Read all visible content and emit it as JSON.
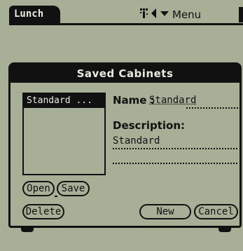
{
  "topbar": {
    "app_name": "Lunch",
    "menu_label": "Menu",
    "icons": [
      "keyboard-icon",
      "sound-icon",
      "dropdown-arrow-icon"
    ]
  },
  "dialog": {
    "title": "Saved Cabinets",
    "list": {
      "items": [
        {
          "label": "Standard ...",
          "selected": true
        }
      ]
    },
    "name_label": "Name :",
    "name_value": "Standard",
    "description_label": "Description:",
    "description_value": "Standard",
    "buttons": {
      "open": "Open",
      "save": "Save",
      "delete": "Delete",
      "new": "New",
      "cancel": "Cancel"
    }
  },
  "colors": {
    "screen": "#a7b097",
    "ink": "#111111",
    "inverse_text": "#e8ece0"
  }
}
